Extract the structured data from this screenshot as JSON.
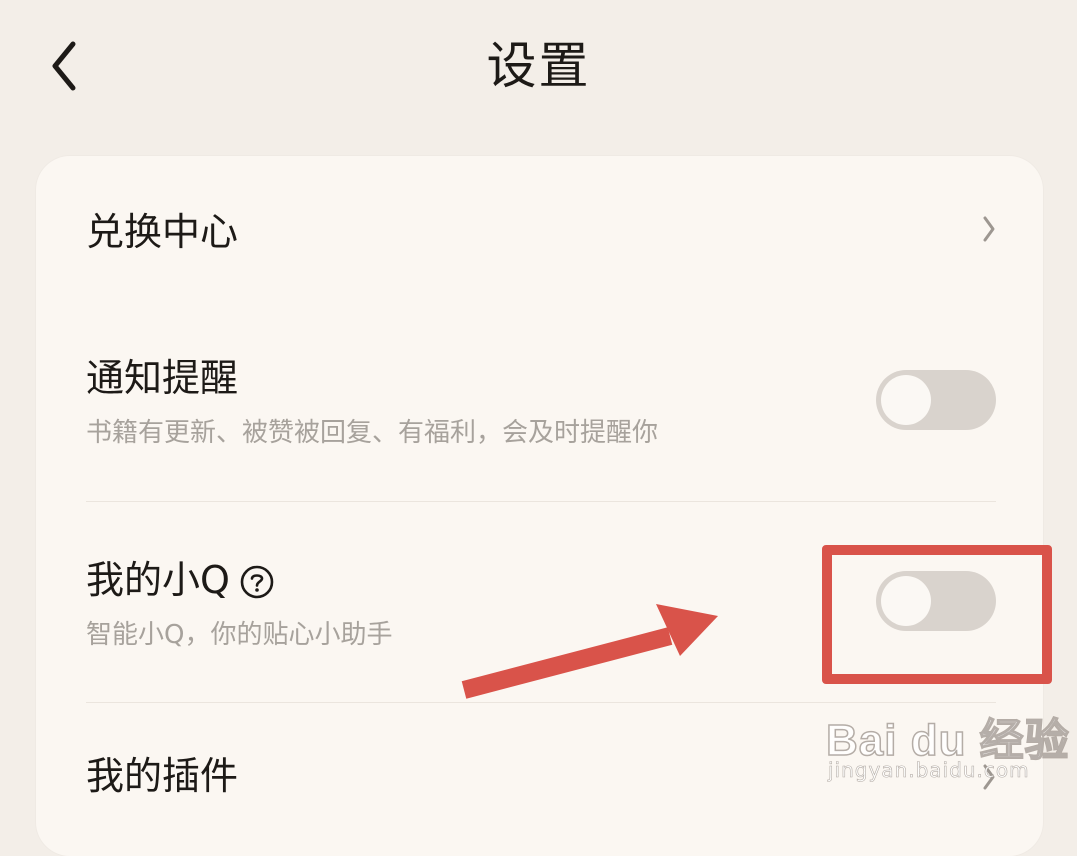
{
  "header": {
    "title": "设置",
    "back_icon": "chevron-left-icon"
  },
  "settings": {
    "items": [
      {
        "title": "兑换中心",
        "control": "chevron"
      },
      {
        "title": "通知提醒",
        "subtitle": "书籍有更新、被赞被回复、有福利，会及时提醒你",
        "control": "toggle",
        "enabled": false
      },
      {
        "title": "我的小Q",
        "subtitle": "智能小Q，你的贴心小助手",
        "control": "toggle",
        "enabled": false,
        "help_icon": "question-circle-icon"
      },
      {
        "title": "我的插件",
        "control": "chevron"
      }
    ]
  },
  "annotation": {
    "box_color": "#d9534a",
    "arrow_color": "#d9534a"
  },
  "watermark": {
    "logo": "Bai du 经验",
    "url": "jingyan.baidu.com"
  },
  "colors": {
    "background": "#f3eee8",
    "card": "#fbf7f2",
    "toggle_off": "#d9d3cd",
    "subtitle": "#a7a29c"
  }
}
